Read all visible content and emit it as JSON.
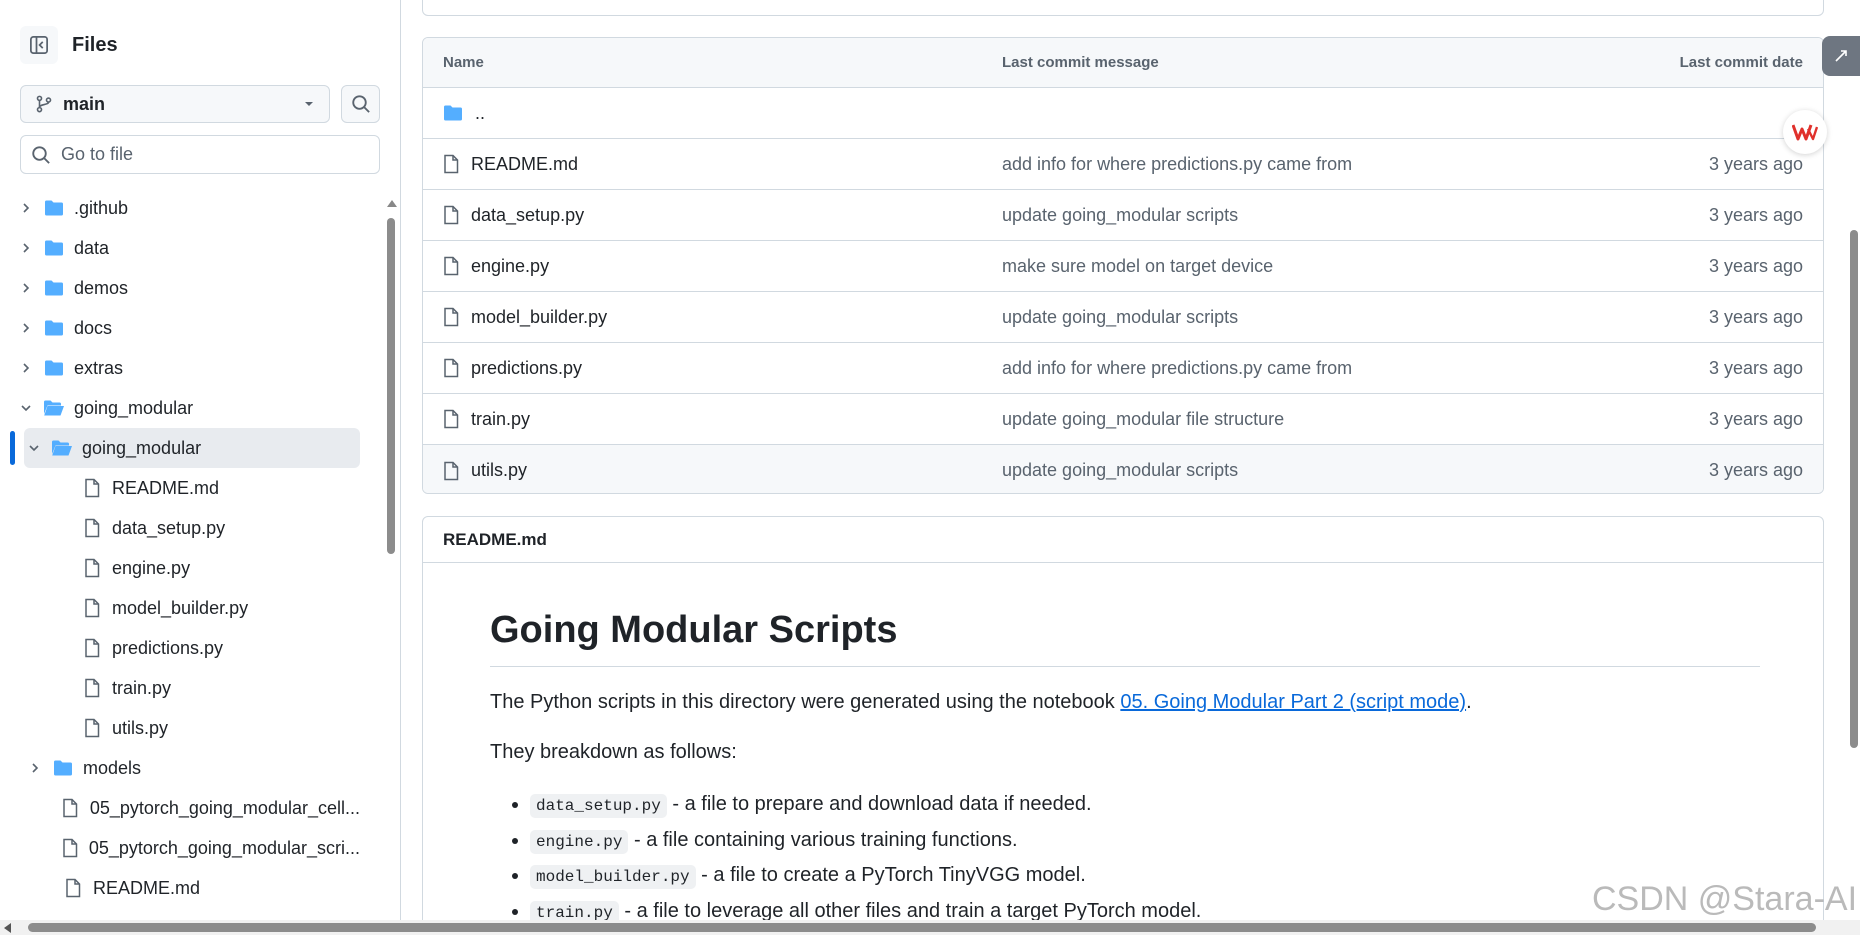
{
  "sidebar": {
    "title": "Files",
    "branch": "main",
    "goto_placeholder": "Go to file",
    "tree": [
      {
        "label": ".github",
        "type": "folder",
        "level": 0,
        "expanded": false
      },
      {
        "label": "data",
        "type": "folder",
        "level": 0,
        "expanded": false
      },
      {
        "label": "demos",
        "type": "folder",
        "level": 0,
        "expanded": false
      },
      {
        "label": "docs",
        "type": "folder",
        "level": 0,
        "expanded": false
      },
      {
        "label": "extras",
        "type": "folder",
        "level": 0,
        "expanded": false
      },
      {
        "label": "going_modular",
        "type": "folder-open",
        "level": 0,
        "expanded": true
      },
      {
        "label": "going_modular",
        "type": "folder-open",
        "level": 1,
        "expanded": true,
        "selected": true
      },
      {
        "label": "README.md",
        "type": "file",
        "level": 2
      },
      {
        "label": "data_setup.py",
        "type": "file",
        "level": 2
      },
      {
        "label": "engine.py",
        "type": "file",
        "level": 2
      },
      {
        "label": "model_builder.py",
        "type": "file",
        "level": 2
      },
      {
        "label": "predictions.py",
        "type": "file",
        "level": 2
      },
      {
        "label": "train.py",
        "type": "file",
        "level": 2
      },
      {
        "label": "utils.py",
        "type": "file",
        "level": 2
      },
      {
        "label": "models",
        "type": "folder",
        "level": 1,
        "expanded": false
      },
      {
        "label": "05_pytorch_going_modular_cell...",
        "type": "file",
        "level": 1
      },
      {
        "label": "05_pytorch_going_modular_scri...",
        "type": "file",
        "level": 1
      },
      {
        "label": "README.md",
        "type": "file",
        "level": 1
      }
    ]
  },
  "table": {
    "headers": {
      "name": "Name",
      "message": "Last commit message",
      "date": "Last commit date"
    },
    "parent": "..",
    "rows": [
      {
        "name": "README.md",
        "message": "add info for where predictions.py came from",
        "date": "3 years ago"
      },
      {
        "name": "data_setup.py",
        "message": "update going_modular scripts",
        "date": "3 years ago"
      },
      {
        "name": "engine.py",
        "message": "make sure model on target device",
        "date": "3 years ago"
      },
      {
        "name": "model_builder.py",
        "message": "update going_modular scripts",
        "date": "3 years ago"
      },
      {
        "name": "predictions.py",
        "message": "add info for where predictions.py came from",
        "date": "3 years ago"
      },
      {
        "name": "train.py",
        "message": "update going_modular file structure",
        "date": "3 years ago"
      },
      {
        "name": "utils.py",
        "message": "update going_modular scripts",
        "date": "3 years ago"
      }
    ]
  },
  "readme": {
    "header": "README.md",
    "title": "Going Modular Scripts",
    "intro_before": "The Python scripts in this directory were generated using the notebook ",
    "intro_link": "05. Going Modular Part 2 (script mode)",
    "intro_after": ".",
    "breakdown": "They breakdown as follows:",
    "items": [
      {
        "code": "data_setup.py",
        "text": " - a file to prepare and download data if needed."
      },
      {
        "code": "engine.py",
        "text": " - a file containing various training functions."
      },
      {
        "code": "model_builder.py",
        "text": " - a file to create a PyTorch TinyVGG model."
      },
      {
        "code": "train.py",
        "text": " - a file to leverage all other files and train a target PyTorch model."
      }
    ]
  },
  "watermark": "CSDN @Stara-AI",
  "colors": {
    "folder": "#54aeff",
    "link": "#0969da",
    "accent": "#0969da",
    "wps_red": "#e0312c"
  }
}
